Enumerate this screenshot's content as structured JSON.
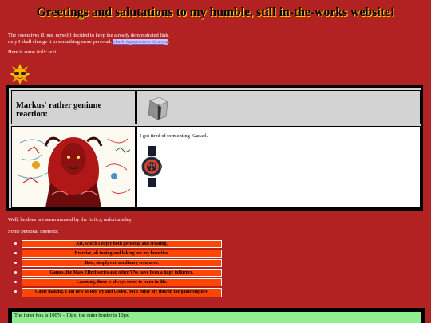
{
  "header": {
    "title": "Greetings and salutations to my humble, still in-the-works website!"
  },
  "intro": {
    "line1": "The executives (I, me, myself) decided to keep the already demonstrated link,",
    "line2_prefix": "only I shall change it to something more personal: ",
    "link_text": "shadowgazer.neocities.org",
    "line2_suffix": "."
  },
  "italic_line": {
    "prefix": "Here is some ",
    "italic": "italic",
    "suffix": " text."
  },
  "icons": {
    "sun": "sunglasses-sun-icon",
    "box": "box-icon",
    "watch": "wristwatch-icon"
  },
  "table": {
    "heading": "Markus' rather geniune reaction:",
    "text": "I got tired of tormenting Kaz'ael."
  },
  "after_text": {
    "prefix": "Well, he does not seem amused by the ",
    "italic": "italics",
    "suffix": ", unfortuntaley."
  },
  "interests": {
    "title": "Some personal interests:",
    "items": [
      "Art, which I enjoy both perusing and creating.",
      "Exercise, ab toning and biking are my favorites.",
      "Bats, simply extraordinary creatures.",
      "Games, the Mass Effect series and other VNs have been a huge influence.",
      "Learning, there is always more to learn in life.",
      "Game making, I am new to Ren'Py and Godot, but I enjoy my time in the game engines."
    ]
  },
  "boxes": {
    "inner_text": "The inner box is 100% - 10px, the outer border is 10px."
  },
  "colors": {
    "background": "#b22222",
    "interest_box": "#ff4500",
    "inner_box": "#90ee90"
  }
}
